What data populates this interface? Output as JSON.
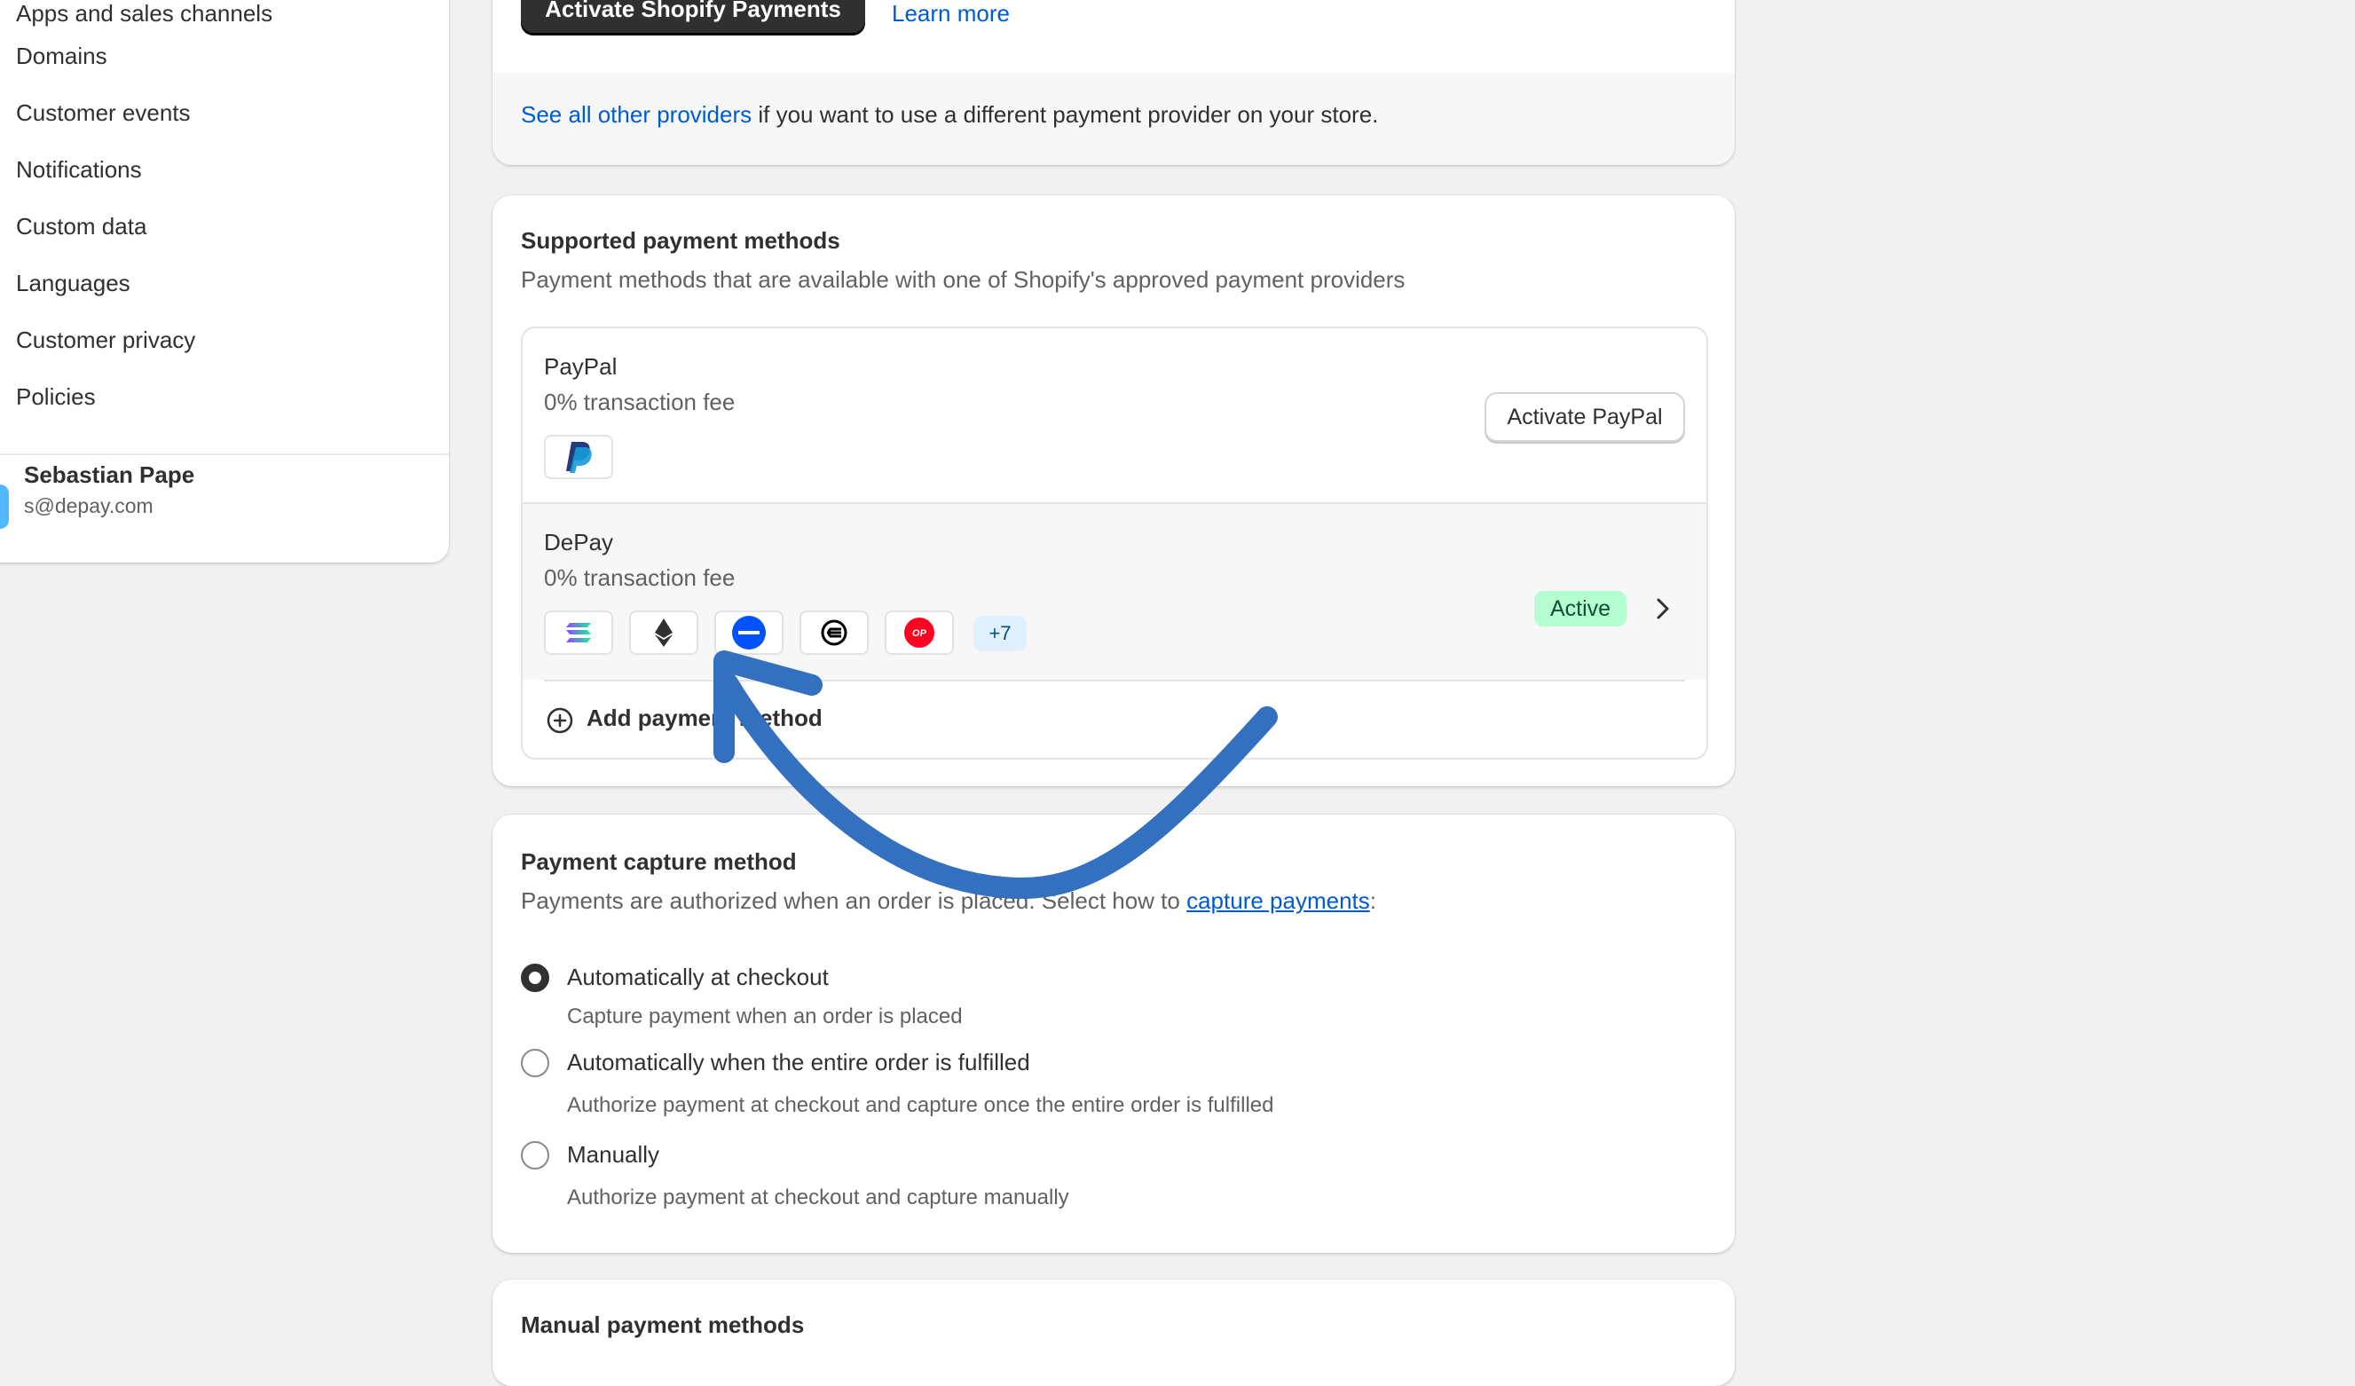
{
  "sidebar": {
    "items": [
      {
        "label": "Apps and sales channels"
      },
      {
        "label": "Domains"
      },
      {
        "label": "Customer events"
      },
      {
        "label": "Notifications"
      },
      {
        "label": "Custom data"
      },
      {
        "label": "Languages"
      },
      {
        "label": "Customer privacy"
      },
      {
        "label": "Policies"
      }
    ],
    "user": {
      "name": "Sebastian Pape",
      "email": "s@depay.com"
    }
  },
  "shopify_payments": {
    "activate_label": "Activate Shopify Payments",
    "learn_more": "Learn more",
    "providers_link": "See all other providers",
    "providers_text": " if you want to use a different payment provider on your store."
  },
  "supported_methods": {
    "title": "Supported payment methods",
    "subtitle": "Payment methods that are available with one of Shopify's approved payment providers",
    "providers": [
      {
        "name": "PayPal",
        "fee": "0% transaction fee",
        "action": "Activate PayPal",
        "icons": [
          "paypal-icon"
        ]
      },
      {
        "name": "DePay",
        "fee": "0% transaction fee",
        "status": "Active",
        "more": "+7",
        "icons": [
          "solana-icon",
          "ethereum-icon",
          "base-icon",
          "worldcoin-icon",
          "optimism-icon"
        ]
      }
    ],
    "add_label": "Add payment method"
  },
  "capture": {
    "title": "Payment capture method",
    "subtitle_prefix": "Payments are authorized when an order is placed. Select how to ",
    "subtitle_link": "capture payments",
    "subtitle_suffix": ":",
    "options": [
      {
        "label": "Automatically at checkout",
        "help": "Capture payment when an order is placed",
        "checked": true
      },
      {
        "label": "Automatically when the entire order is fulfilled",
        "help": "Authorize payment at checkout and capture once the entire order is fulfilled",
        "checked": false
      },
      {
        "label": "Manually",
        "help": "Authorize payment at checkout and capture manually",
        "checked": false
      }
    ]
  },
  "manual_methods": {
    "title": "Manual payment methods"
  },
  "colors": {
    "accent_link": "#005bd3",
    "annotation_arrow": "#3370bf",
    "active_badge": "#b4fed2"
  }
}
